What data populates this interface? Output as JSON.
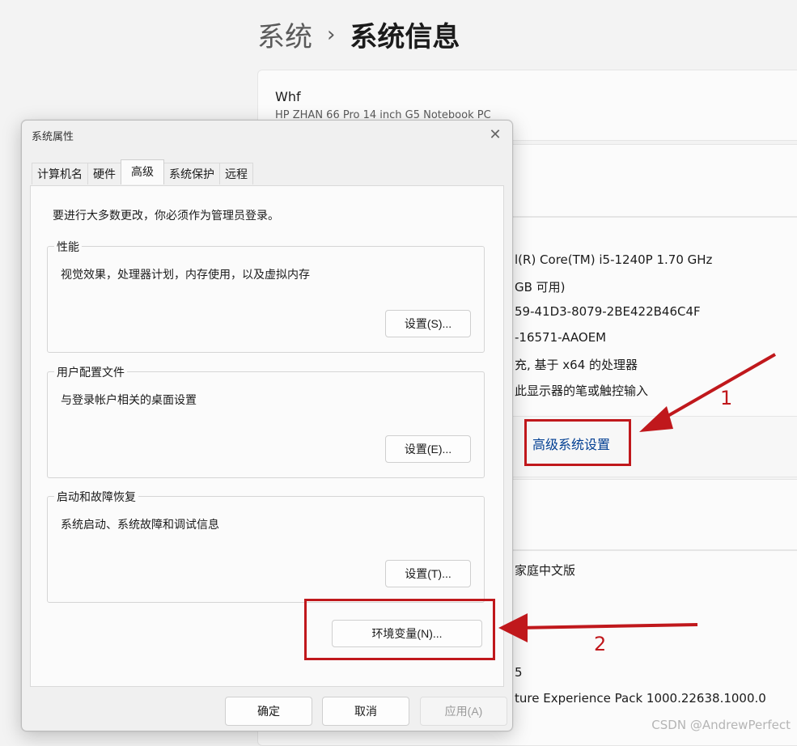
{
  "settings": {
    "breadcrumb": {
      "parent": "系统",
      "separator": "›",
      "current": "系统信息"
    },
    "device": {
      "name": "Whf",
      "model": "HP ZHAN 66 Pro 14 inch G5 Notebook PC"
    },
    "spec_values": [
      "l(R) Core(TM) i5-1240P   1.70 GHz",
      "GB 可用)",
      "59-41D3-8079-2BE422B46C4F",
      "-16571-AAOEM",
      "充, 基于 x64 的处理器",
      "此显示器的笔或触控输入"
    ],
    "advanced_link": "高级系统设置",
    "edition_value": "家庭中文版",
    "version_digit": "5",
    "experience_value": "ture Experience Pack 1000.22638.1000.0"
  },
  "annotations": {
    "step1": "1",
    "step2": "2",
    "arrow_color": "#c0181c"
  },
  "watermark": "CSDN @AndrewPerfect",
  "dialog": {
    "title": "系统属性",
    "close_icon": "close-icon",
    "tabs": [
      {
        "label": "计算机名"
      },
      {
        "label": "硬件"
      },
      {
        "label": "高级"
      },
      {
        "label": "系统保护"
      },
      {
        "label": "远程"
      }
    ],
    "active_tab": "高级",
    "notice": "要进行大多数更改，你必须作为管理员登录。",
    "groups": {
      "performance": {
        "legend": "性能",
        "description": "视觉效果，处理器计划，内存使用，以及虚拟内存",
        "button": "设置(S)..."
      },
      "profile": {
        "legend": "用户配置文件",
        "description": "与登录帐户相关的桌面设置",
        "button": "设置(E)..."
      },
      "startup": {
        "legend": "启动和故障恢复",
        "description": "系统启动、系统故障和调试信息",
        "button": "设置(T)..."
      }
    },
    "env_button": "环境变量(N)...",
    "footer": {
      "ok": "确定",
      "cancel": "取消",
      "apply": "应用(A)"
    }
  }
}
